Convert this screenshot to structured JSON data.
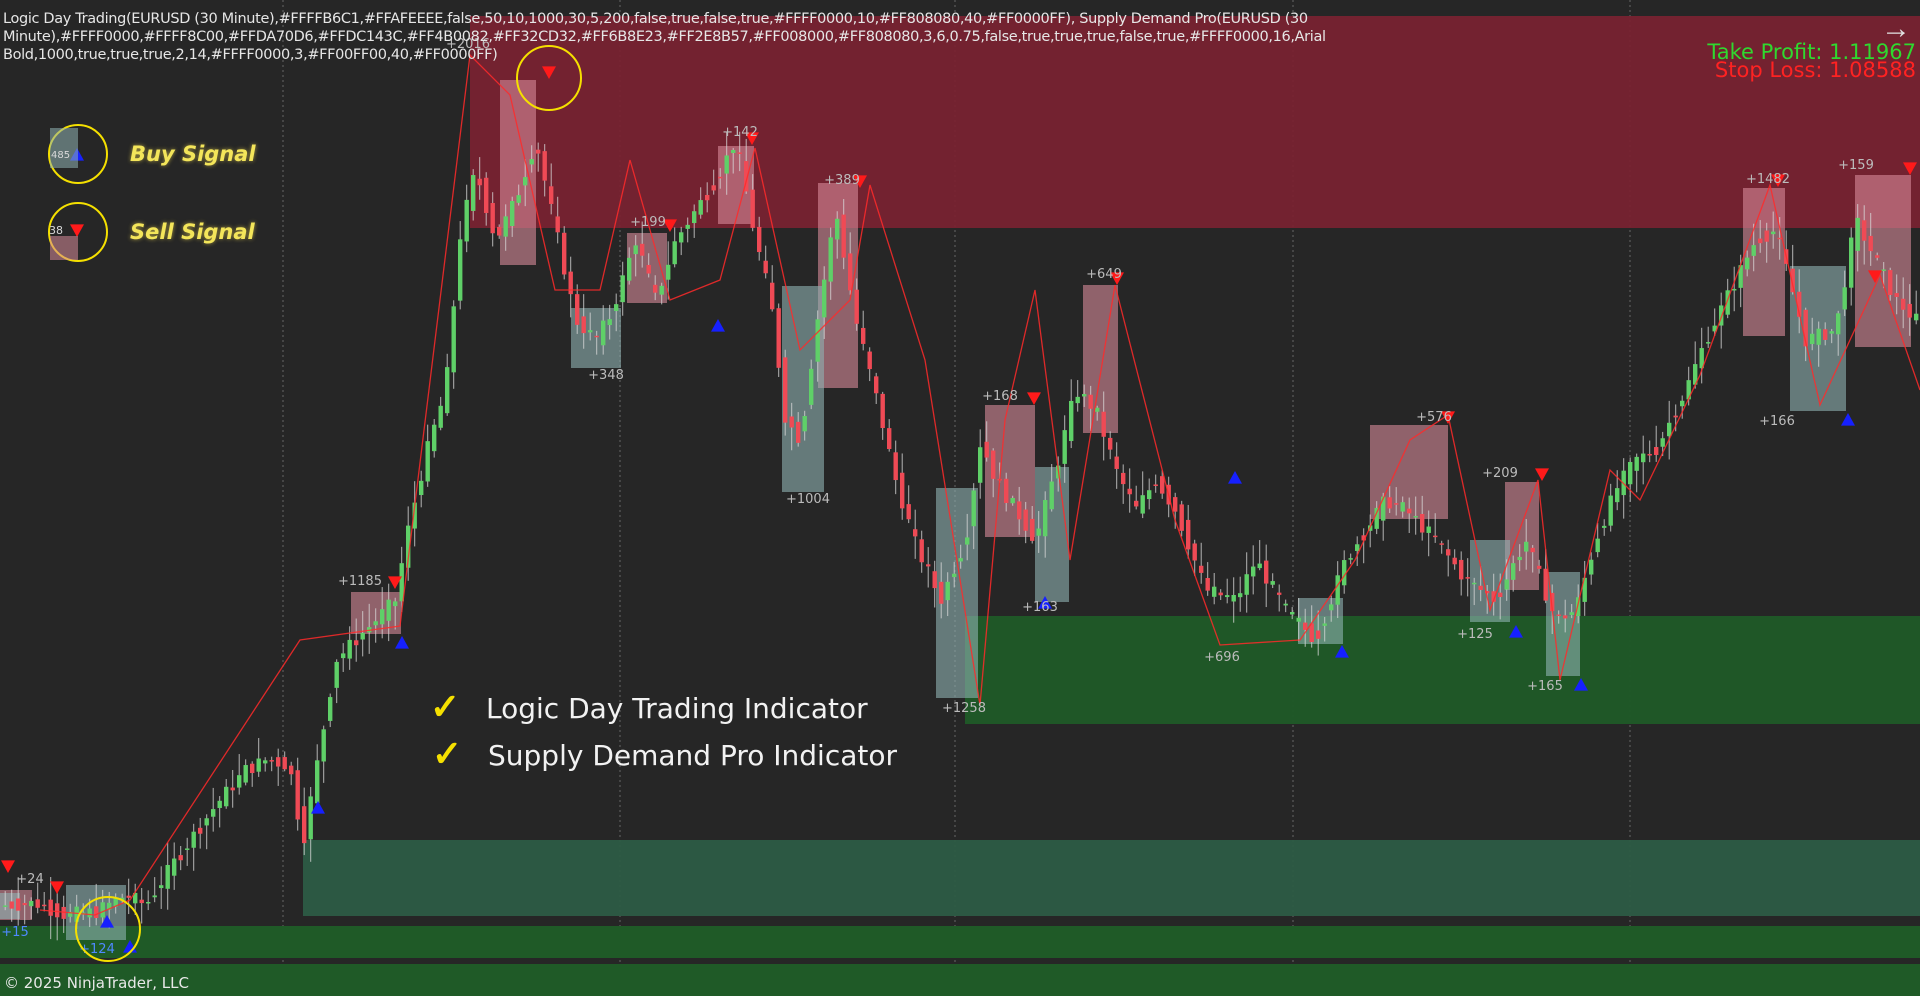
{
  "header_text": "Logic Day Trading(EURUSD (30 Minute),#FFFFB6C1,#FFAFEEEE,false,50,10,1000,30,5,200,false,true,false,true,#FFFF0000,10,#FF808080,40,#FF0000FF), Supply Demand Pro(EURUSD (30 Minute),#FFFF0000,#FFFF8C00,#FFDA70D6,#FFDC143C,#FF4B0082,#FF32CD32,#FF6B8E23,#FF2E8B57,#FF008000,#FF808080,3,6,0.75,false,true,true,true,false,true,#FFFF0000,16,Arial Bold,1000,true,true,true,2,14,#FFFF0000,3,#FF00FF00,40,#FF0000FF)",
  "take_profit": "Take Profit: 1.11967",
  "stop_loss": "Stop Loss: 1.08588",
  "colors": {
    "take_profit": "#2fd92f",
    "stop_loss": "#ff2222",
    "bull_candle": "#5fd068",
    "bear_candle": "#ef4a55",
    "supply_zone": "#7a2231",
    "demand_zone": "#1f5a27",
    "demand_zone_light": "#2c5b44",
    "buy_box": "#8fb3b3",
    "sell_box": "#d78b99",
    "signal_line": "#ff2a2a",
    "highlight_circle": "#f5e000"
  },
  "legend": {
    "buy_label": "Buy Signal",
    "sell_label": "Sell Signal",
    "buy_sample": "485",
    "sell_sample": "38"
  },
  "promo": {
    "line1": "Logic Day Trading Indicator",
    "line2": "Supply Demand Pro Indicator",
    "check": "✓"
  },
  "copyright": "© 2025 NinjaTrader, LLC",
  "signal_labels": {
    "sell": [
      "+2016",
      "+142",
      "+199",
      "+389",
      "+1185",
      "+649",
      "+168",
      "+576",
      "+209",
      "+1482",
      "+159",
      "+24"
    ],
    "buy": [
      "+348",
      "+1004",
      "+163",
      "+696",
      "+1258",
      "+125",
      "+165",
      "+166",
      "+15",
      "+124"
    ]
  },
  "icons": {
    "nav_arrow": "arrow-right-icon",
    "buy": "triangle-up-icon",
    "sell": "triangle-down-icon"
  }
}
